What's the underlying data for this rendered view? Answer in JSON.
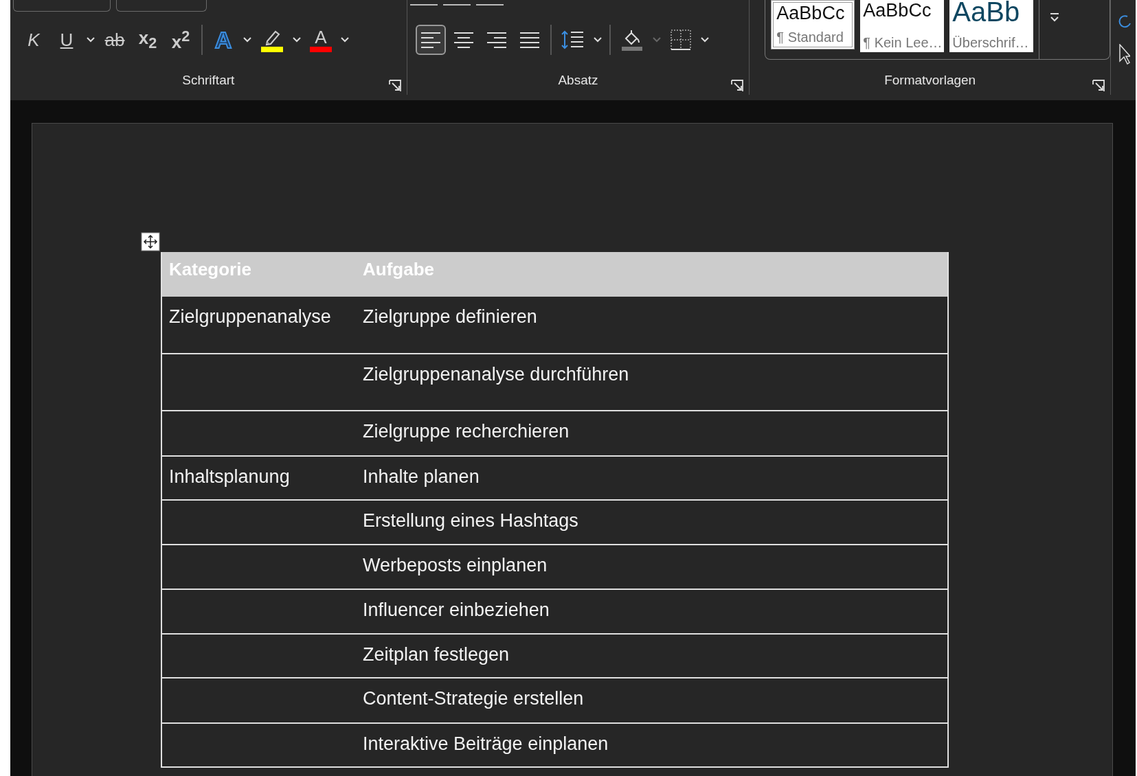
{
  "ribbon": {
    "font_buttons": [
      {
        "kind": "italic",
        "glyph": "K",
        "dropdown": false
      },
      {
        "kind": "underline",
        "glyph": "U",
        "dropdown": true
      },
      {
        "kind": "strike",
        "glyph": "ab",
        "dropdown": false
      },
      {
        "kind": "subscript",
        "glyph": "x$_{2}$",
        "dropdown": false
      },
      {
        "kind": "superscript",
        "glyph": "x$^{2}$",
        "dropdown": false
      },
      {
        "kind": "effects",
        "glyph": "A",
        "dropdown": true
      },
      {
        "kind": "highlight",
        "color": "#ffff00",
        "dropdown": true
      },
      {
        "kind": "fontcolor",
        "glyph": "A",
        "color": "#ff0000",
        "dropdown": true
      }
    ],
    "font_label": "Schriftart",
    "alignments": [
      {
        "kind": "left",
        "selected": true
      },
      {
        "kind": "center",
        "selected": false
      },
      {
        "kind": "right",
        "selected": false
      },
      {
        "kind": "justify",
        "selected": false
      }
    ],
    "paragraph_label": "Absatz",
    "styles": [
      {
        "preview": "AaBbCc",
        "name": "¶ Standard",
        "kind": "normal",
        "selected": true
      },
      {
        "preview": "AaBbCc",
        "name": "¶ Kein Lee…",
        "kind": "normal",
        "selected": false
      },
      {
        "preview": "AaBb",
        "name": "Überschrif…",
        "kind": "heading",
        "selected": false
      }
    ],
    "styles_label": "Formatvorlagen"
  },
  "table": {
    "columns": [
      "Kategorie",
      "Aufgabe"
    ],
    "rows": [
      {
        "category": "Zielgruppenanalyse",
        "task": "Zielgruppe definieren"
      },
      {
        "category": "",
        "task": "Zielgruppenanalyse durchführen"
      },
      {
        "category": "",
        "task": "Zielgruppe recherchieren"
      },
      {
        "category": "Inhaltsplanung",
        "task": "Inhalte planen"
      },
      {
        "category": "",
        "task": "Erstellung eines Hashtags"
      },
      {
        "category": "",
        "task": "Werbeposts einplanen"
      },
      {
        "category": "",
        "task": "Influencer einbeziehen"
      },
      {
        "category": "",
        "task": "Zeitplan festlegen"
      },
      {
        "category": "",
        "task": "Content-Strategie erstellen"
      },
      {
        "category": "",
        "task": "Interaktive Beiträge einplanen"
      }
    ]
  }
}
